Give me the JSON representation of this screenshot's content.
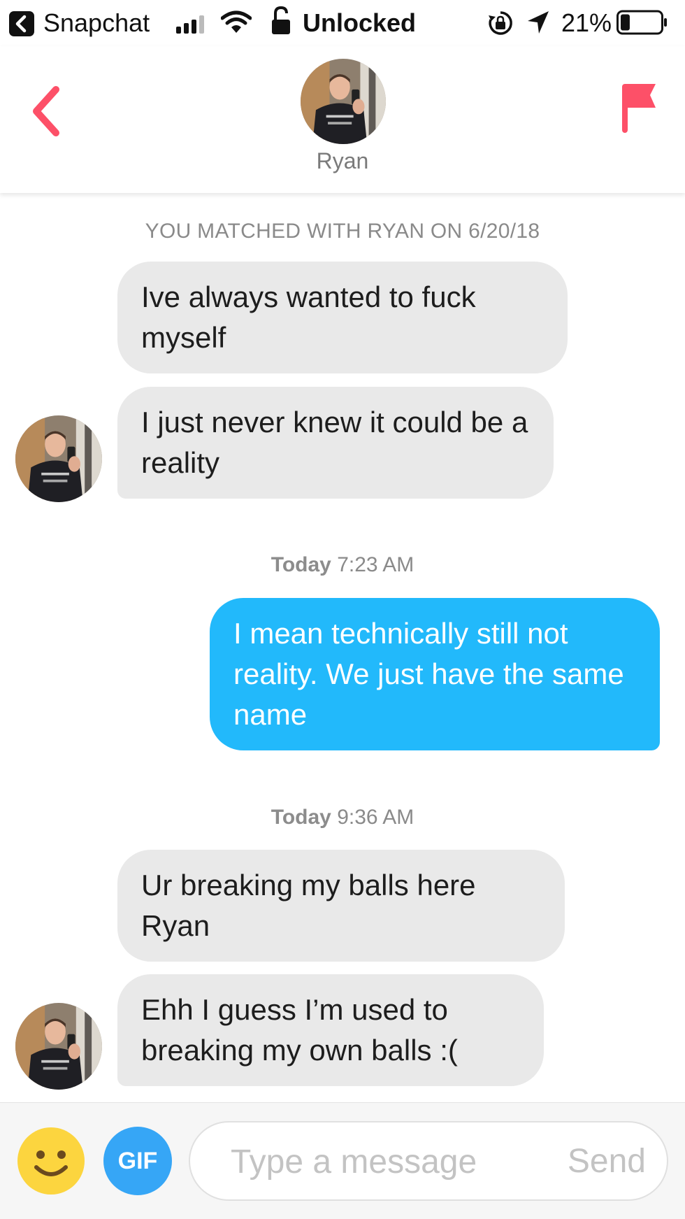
{
  "status_bar": {
    "back_app": "Snapchat",
    "lock_status": "Unlocked",
    "battery_percent": "21%",
    "battery_level": 0.21
  },
  "header": {
    "contact_name": "Ryan",
    "icons": {
      "back": "chevron-left-icon",
      "report": "flag-icon"
    },
    "accent_color": "#fd5068"
  },
  "conversation": {
    "match_notice": "YOU MATCHED WITH RYAN ON 6/20/18",
    "groups": [
      {
        "messages": [
          {
            "from": "them",
            "text": "Ive always wanted to fuck myself"
          },
          {
            "from": "them",
            "text": "I just never knew it could be a reality"
          }
        ]
      },
      {
        "timestamp_day": "Today",
        "timestamp_time": "7:23 AM",
        "messages": [
          {
            "from": "me",
            "text": "I mean technically still not reality. We just have the same name"
          }
        ]
      },
      {
        "timestamp_day": "Today",
        "timestamp_time": "9:36 AM",
        "messages": [
          {
            "from": "them",
            "text": "Ur breaking my balls here Ryan"
          },
          {
            "from": "them",
            "text": "Ehh I guess I’m used to breaking my own balls :("
          }
        ]
      }
    ]
  },
  "composer": {
    "emoji_icon": "smiley-icon",
    "gif_label": "GIF",
    "placeholder": "Type a message",
    "send_label": "Send"
  },
  "colors": {
    "sent_bubble": "#22b9fb",
    "received_bubble": "#e9e9e9",
    "gif_button": "#36a6f6",
    "emoji": "#fcd53f"
  }
}
